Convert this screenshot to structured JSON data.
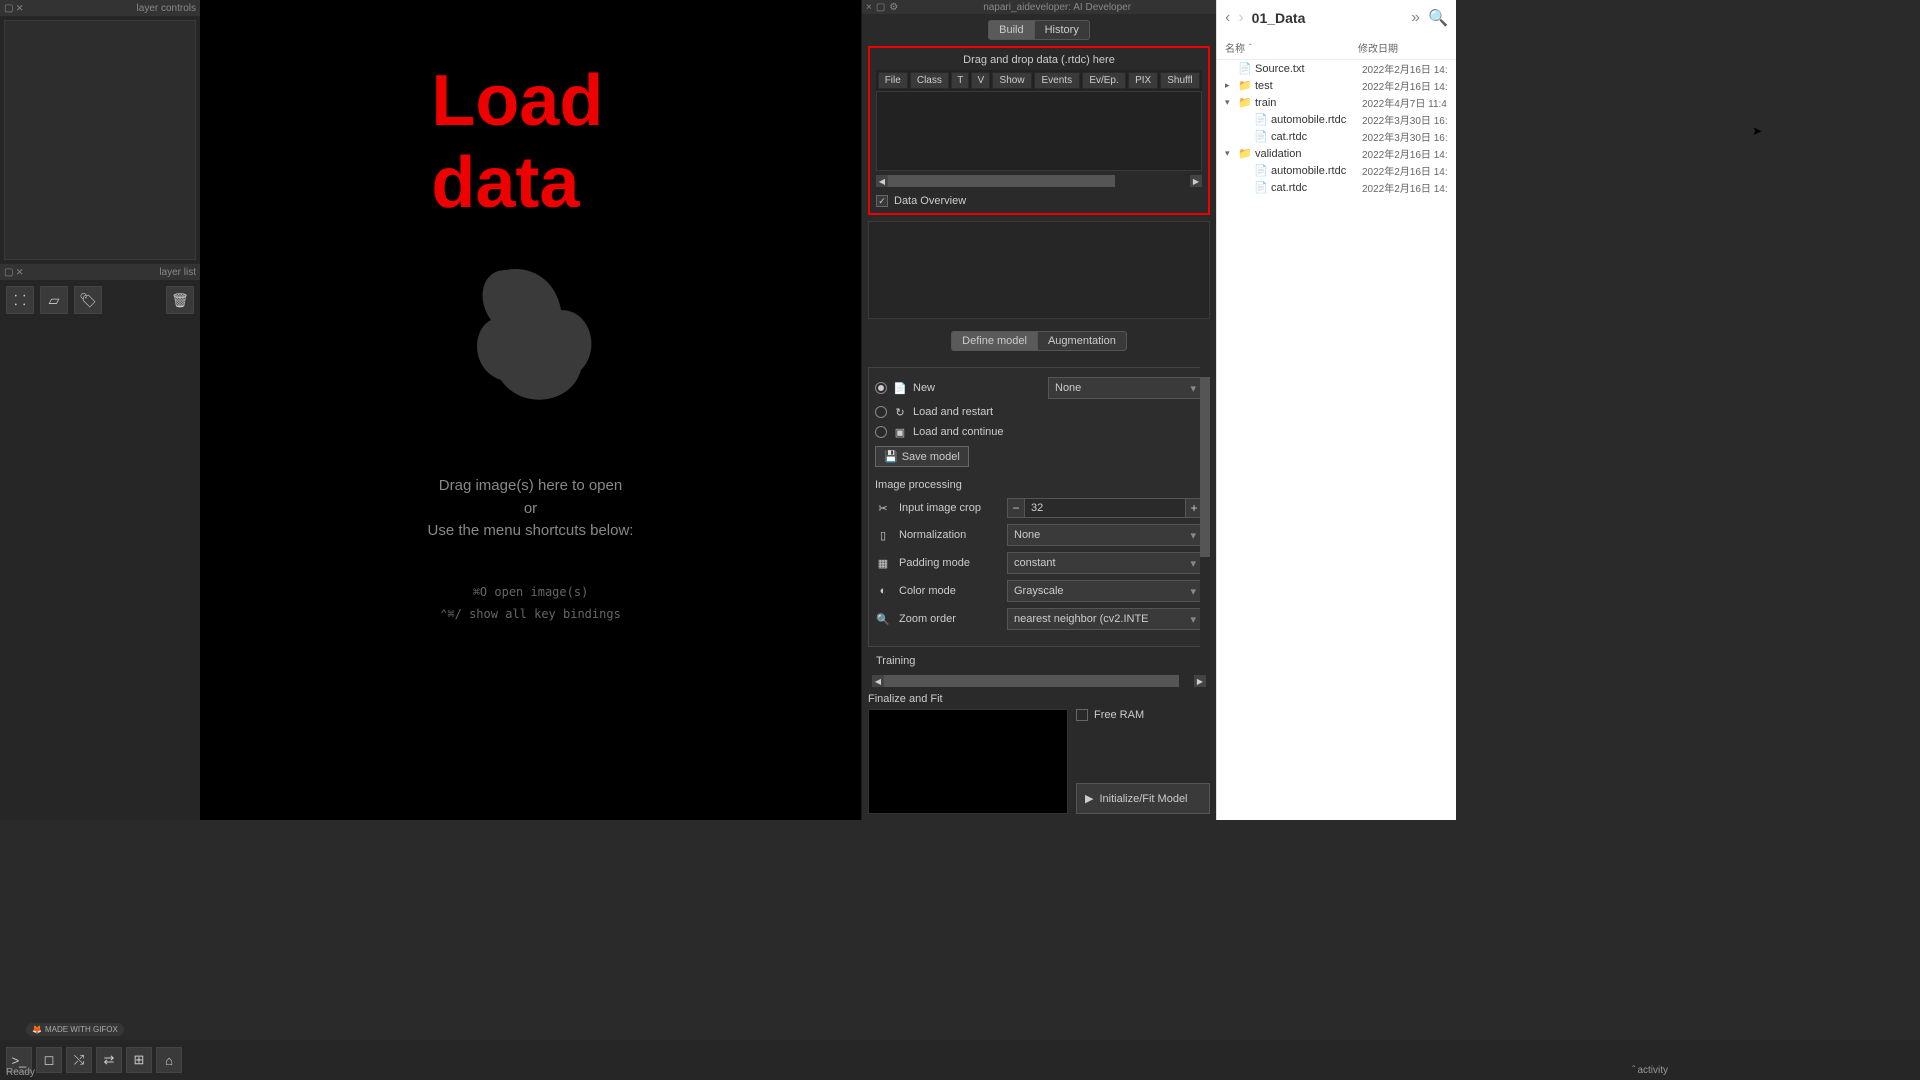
{
  "leftPanel": {
    "layerControlsTitle": "layer controls",
    "layerListTitle": "layer list"
  },
  "center": {
    "bigTitle": "Load data",
    "dropLine1": "Drag image(s) here to open",
    "dropLine2": "or",
    "dropLine3": "Use the menu shortcuts below:",
    "shortcut1": "⌘O   open image(s)",
    "shortcut2": "⌃⌘/   show all key bindings"
  },
  "rightPanel": {
    "dockTitle": "napari_aideveloper: AI Developer",
    "tabs": {
      "build": "Build",
      "history": "History"
    },
    "dropLabel": "Drag and drop data (.rtdc) here",
    "tableHeaders": [
      "File",
      "Class",
      "T",
      "V",
      "Show",
      "Events",
      "Ev/Ep.",
      "PIX",
      "Shuffl"
    ],
    "dataOverview": "Data Overview",
    "modelTabs": {
      "define": "Define model",
      "augment": "Augmentation"
    },
    "newLabel": "New",
    "newDropdown": "None",
    "loadRestart": "Load and restart",
    "loadContinue": "Load and continue",
    "saveModel": "Save model",
    "imageProcessing": "Image processing",
    "inputCrop": {
      "label": "Input image crop",
      "value": "32"
    },
    "normalization": {
      "label": "Normalization",
      "value": "None"
    },
    "padding": {
      "label": "Padding mode",
      "value": "constant"
    },
    "colorMode": {
      "label": "Color mode",
      "value": "Grayscale"
    },
    "zoomOrder": {
      "label": "Zoom order",
      "value": "nearest neighbor (cv2.INTE"
    },
    "training": "Training",
    "finalize": "Finalize and Fit",
    "freeRam": "Free RAM",
    "fitBtn": "Initialize/Fit Model"
  },
  "status": {
    "ready": "Ready",
    "activity": "activity"
  },
  "gifox": "MADE WITH GIFOX",
  "finder": {
    "title": "01_Data",
    "colName": "名称",
    "colDate": "修改日期",
    "items": [
      {
        "indent": 0,
        "type": "file",
        "name": "Source.txt",
        "date": "2022年2月16日 14:"
      },
      {
        "indent": 0,
        "type": "folder",
        "expanded": false,
        "name": "test",
        "date": "2022年2月16日 14:"
      },
      {
        "indent": 0,
        "type": "folder",
        "expanded": true,
        "name": "train",
        "date": "2022年4月7日 11:4"
      },
      {
        "indent": 1,
        "type": "file",
        "name": "automobile.rtdc",
        "date": "2022年3月30日 16:"
      },
      {
        "indent": 1,
        "type": "file",
        "name": "cat.rtdc",
        "date": "2022年3月30日 16:"
      },
      {
        "indent": 0,
        "type": "folder",
        "expanded": true,
        "name": "validation",
        "date": "2022年2月16日 14:"
      },
      {
        "indent": 1,
        "type": "file",
        "name": "automobile.rtdc",
        "date": "2022年2月16日 14:"
      },
      {
        "indent": 1,
        "type": "file",
        "name": "cat.rtdc",
        "date": "2022年2月16日 14:"
      }
    ]
  }
}
